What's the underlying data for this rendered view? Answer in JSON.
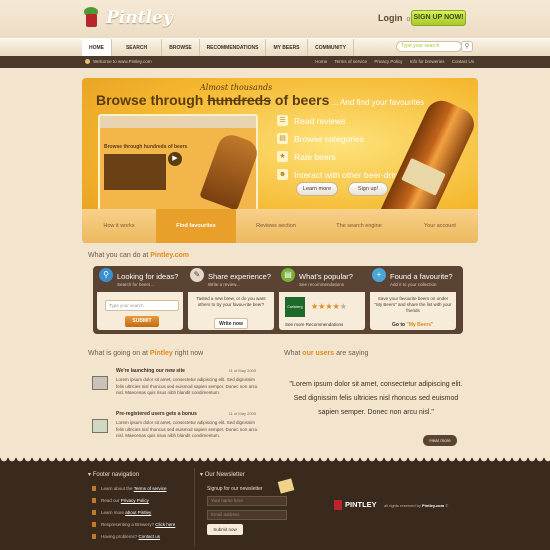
{
  "header": {
    "logo_text": "Pintley",
    "login": "Login",
    "or": "or",
    "signup": "SIGN UP NOW!"
  },
  "nav": {
    "items": [
      "HOME",
      "SEARCH",
      "BROWSE",
      "RECOMMENDATIONS",
      "MY BEERS",
      "COMMUNITY"
    ],
    "search_placeholder": "Type your search"
  },
  "subnav": {
    "welcome": "Welcome to www.Pintley.com",
    "links": [
      "Home",
      "Terms of service",
      "Privacy Policy",
      "Info for breweries",
      "Contact Us"
    ]
  },
  "hero": {
    "headline_prefix": "Browse through ",
    "headline_strike": "hundreds",
    "headline_suffix": " of beers",
    "headline_tail": " ... And find your favourites",
    "annotation": "Almost thousands",
    "mini_title": "Browse through hundreds of beers",
    "features": [
      "Read reviews",
      "Browse categories",
      "Rate beers",
      "Interact with other beer-drinkers"
    ],
    "learn_more": "Learn more",
    "sign_up": "Sign up!",
    "tabs": [
      "How it works",
      "Find favourites",
      "Reviews section",
      "The search engine",
      "Your account"
    ]
  },
  "what_you_can_do": {
    "title_prefix": "What you can do at ",
    "title_brand": "Pintley.com",
    "cards": [
      {
        "title": "Looking for ideas?",
        "sub": "Search for beers...",
        "input_placeholder": "Type your search",
        "button": "SUBMIT"
      },
      {
        "title": "Share experience?",
        "sub": "Write a review...",
        "text": "Tasted a new brew, or do you want others to try your favou-rite beer?",
        "button": "Write now"
      },
      {
        "title": "What's popular?",
        "sub": "See recommendations",
        "brand": "Carlsberg",
        "link": "See more Recommendations"
      },
      {
        "title": "Found a favourite?",
        "sub": "Add it to your collection",
        "text": "Save your favourite beers on under \"My Beers\" and share the list with your friends",
        "link_prefix": "Go to ",
        "link": "\"My Beers\""
      }
    ]
  },
  "going_on": {
    "title_prefix": "What is going on at ",
    "title_brand": "Pintley",
    "title_suffix": " right now",
    "items": [
      {
        "title": "We're launching our new site",
        "date": "11 of May 2009",
        "body": "Lorem ipsum dolor sit amet, consectetur adipiscing elit. Sed dignissim felis ultricies nisl rhoncus sed euismod sapien semper. Donec non arcu nisl. Maecenas quis risus nibh blandit condimentum."
      },
      {
        "title": "Pre-registered users gets a bonus",
        "date": "11 of May 2009",
        "body": "Lorem ipsum dolor sit amet, consectetur adipiscing elit. Sed dignissim felis ultricies nisl rhoncus sed euismod sapien semper. Donec non arcu nisl. Maecenas quis risus nibh blandit condimentum."
      }
    ]
  },
  "users_saying": {
    "title_prefix": "What ",
    "title_accent": "our users",
    "title_suffix": " are saying",
    "quote": "\"Lorem ipsum dolor sit amet, consectetur adipiscing elit. Sed dignissim felis ultricies nisl rhoncus sed euismod sapien semper. Donec non arcu nisl.\"",
    "more": "Hear more"
  },
  "footer": {
    "nav_title": "Footer navigation",
    "links": [
      {
        "prefix": "Learn about the ",
        "link": "Terms of service"
      },
      {
        "prefix": "Read our ",
        "link": "Privacy Policy"
      },
      {
        "prefix": "Learn more ",
        "link": "about Pintley"
      },
      {
        "prefix": "Respresenting a Brewery? ",
        "link": "Click here"
      },
      {
        "prefix": "Having problems? ",
        "link": "Contact us"
      }
    ],
    "newsletter_title": "Our Newsletter",
    "signup_label": "Signup for our newsletter",
    "name_placeholder": "Your name here",
    "email_placeholder": "Email address",
    "submit": "Submit now",
    "logo": "PINTLEY",
    "rights_prefix": "all rights reserved by ",
    "rights_brand": "Pintley.com",
    "rights_suffix": " ©"
  }
}
